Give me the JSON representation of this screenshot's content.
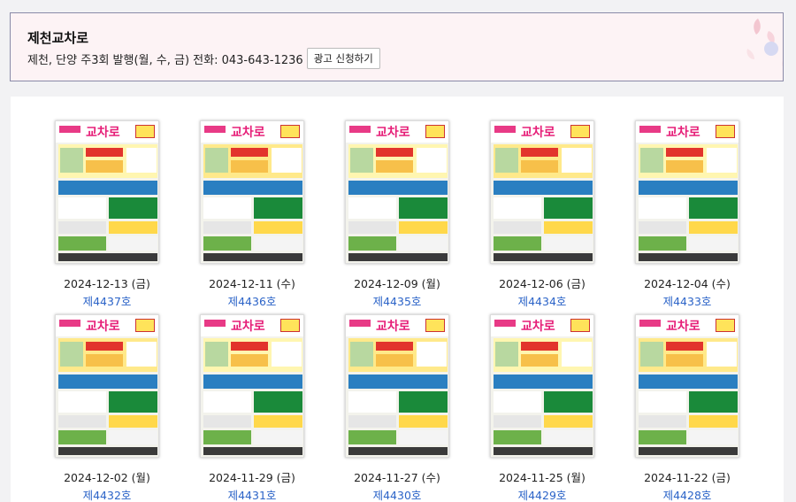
{
  "header": {
    "title": "제천교차로",
    "subtitle": "제천, 단양 주3회 발행(월, 수, 금) 전화: 043-643-1236",
    "ad_button": "광고 신청하기"
  },
  "thumbnail": {
    "logo": "교차로"
  },
  "issues": [
    {
      "date": "2024-12-13 (금)",
      "no": "제4437호"
    },
    {
      "date": "2024-12-11 (수)",
      "no": "제4436호"
    },
    {
      "date": "2024-12-09 (월)",
      "no": "제4435호"
    },
    {
      "date": "2024-12-06 (금)",
      "no": "제4434호"
    },
    {
      "date": "2024-12-04 (수)",
      "no": "제4433호"
    },
    {
      "date": "2024-12-02 (월)",
      "no": "제4432호"
    },
    {
      "date": "2024-11-29 (금)",
      "no": "제4431호"
    },
    {
      "date": "2024-11-27 (수)",
      "no": "제4430호"
    },
    {
      "date": "2024-11-25 (월)",
      "no": "제4429호"
    },
    {
      "date": "2024-11-22 (금)",
      "no": "제4428호"
    }
  ],
  "colors": {
    "header_bg": "#fdf3f5",
    "link": "#2c64c8",
    "brand_pink": "#e61e78",
    "thumb_yellow": "#fff2a0",
    "thumb_green": "#1a8a3a"
  }
}
